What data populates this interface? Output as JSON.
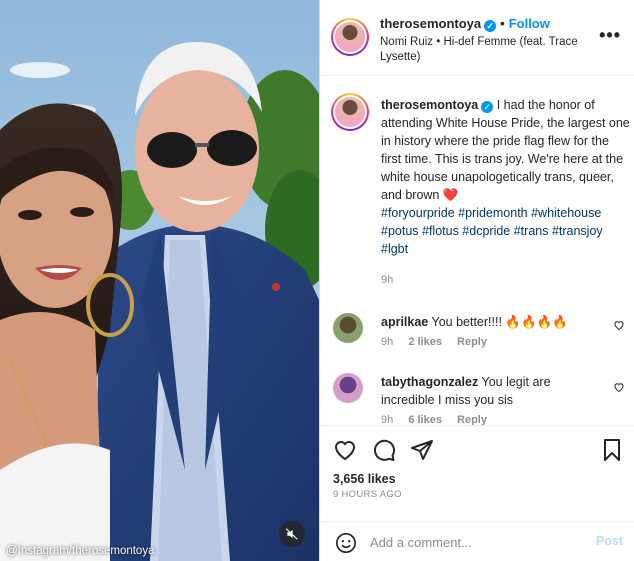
{
  "media": {
    "credit": "@Instagram/therosemontoya"
  },
  "header": {
    "username": "therosemontoya",
    "follow_label": "Follow",
    "audio": "Nomi Ruiz • Hi-def Femme (feat. Trace Lysette)"
  },
  "caption": {
    "username": "therosemontoya",
    "text": "I had the honor of attending White House Pride, the largest one in history where the pride flag flew for the first time. This is trans joy. We're here at the white house unapologetically trans, queer, and brown",
    "hashtags": "#foryourpride #pridemonth #whitehouse #potus #flotus #dcpride #trans #transjoy #lgbt",
    "time": "9h"
  },
  "comments": [
    {
      "username": "aprilkae",
      "text": "You better!!!! 🔥🔥🔥🔥",
      "time": "9h",
      "likes": "2 likes",
      "reply": "Reply"
    },
    {
      "username": "tabythagonzalez",
      "text": "You legit are incredible I miss you sis",
      "time": "9h",
      "likes": "6 likes",
      "reply": "Reply"
    }
  ],
  "actions": {
    "likes": "3,656 likes",
    "ago": "9 HOURS AGO"
  },
  "composer": {
    "placeholder": "Add a comment...",
    "post_label": "Post"
  },
  "colors": {
    "accent": "#0095f6",
    "hashtag": "#00376b",
    "muted": "#8e8e8e"
  }
}
